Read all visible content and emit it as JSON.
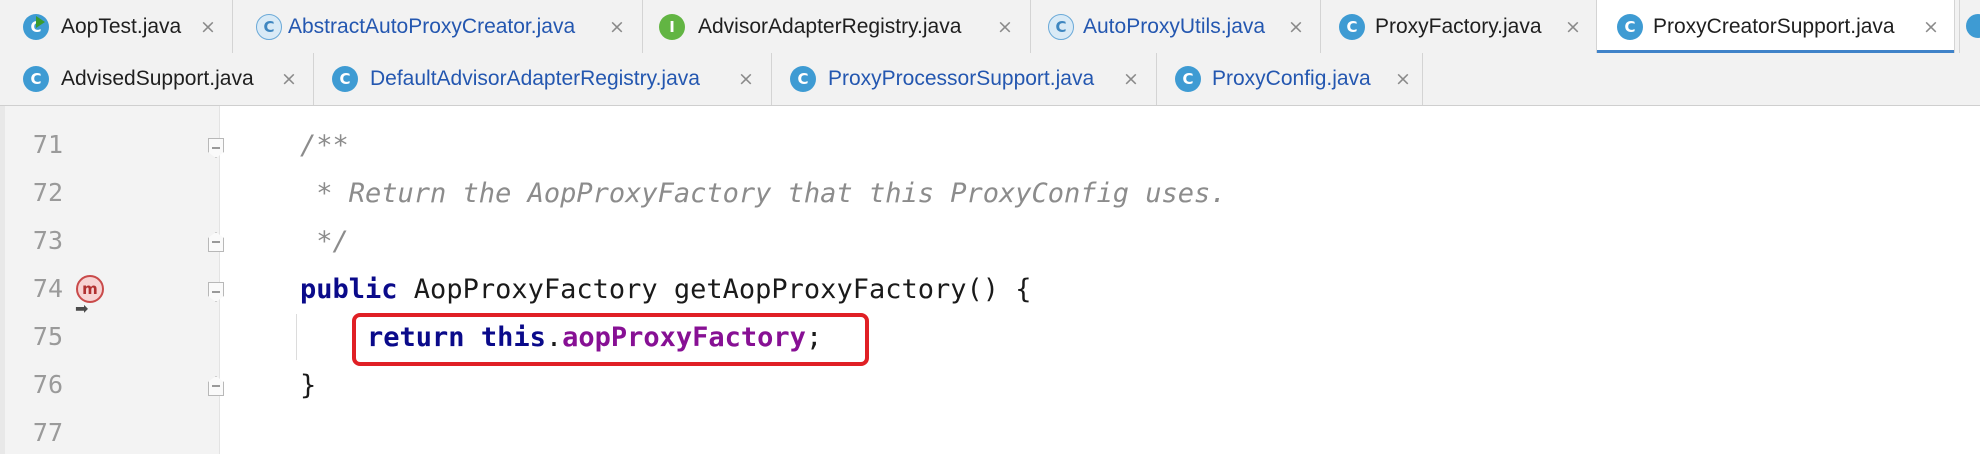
{
  "tabs_row1": [
    {
      "label": "AopTest.java",
      "icon": "c-run-icon",
      "icon_glyph": "C",
      "close": "×",
      "color": "dark"
    },
    {
      "label": "AbstractAutoProxyCreator.java",
      "icon": "class-icon",
      "icon_glyph": "C",
      "close": "×",
      "color": "blue"
    },
    {
      "label": "AdvisorAdapterRegistry.java",
      "icon": "interface-icon",
      "icon_glyph": "I",
      "close": "×",
      "color": "dark"
    },
    {
      "label": "AutoProxyUtils.java",
      "icon": "class-icon",
      "icon_glyph": "C",
      "close": "×",
      "color": "blue"
    },
    {
      "label": "ProxyFactory.java",
      "icon": "class-icon",
      "icon_glyph": "C",
      "close": "×",
      "color": "dark"
    },
    {
      "label": "ProxyCreatorSupport.java",
      "icon": "class-icon",
      "icon_glyph": "C",
      "close": "×",
      "color": "dark",
      "active": true
    }
  ],
  "tabs_row2": [
    {
      "label": "AdvisedSupport.java",
      "icon": "class-icon",
      "icon_glyph": "C",
      "close": "×",
      "color": "dark"
    },
    {
      "label": "DefaultAdvisorAdapterRegistry.java",
      "icon": "class-icon",
      "icon_glyph": "C",
      "close": "×",
      "color": "blue"
    },
    {
      "label": "ProxyProcessorSupport.java",
      "icon": "class-icon",
      "icon_glyph": "C",
      "close": "×",
      "color": "blue"
    },
    {
      "label": "ProxyConfig.java",
      "icon": "class-icon",
      "icon_glyph": "C",
      "close": "×",
      "color": "blue"
    }
  ],
  "line_numbers": [
    "71",
    "72",
    "73",
    "74",
    "75",
    "76",
    "77"
  ],
  "code": {
    "l71": "/**",
    "l72": " * Return the AopProxyFactory that this ProxyConfig uses.",
    "l73": " */",
    "l74_kw": "public",
    "l74_rest": " AopProxyFactory getAopProxyFactory() {",
    "l75_kw1": "return",
    "l75_kw2": "this",
    "l75_dot": ".",
    "l75_field": "aopProxyFactory",
    "l75_end": ";",
    "l76": "}"
  },
  "gutter": {
    "method_badge": "m"
  },
  "colors": {
    "keyword": "#0a0a8a",
    "field": "#871094",
    "comment": "#8c8c8c",
    "highlight_box": "#e02025",
    "active_tab_underline": "#4083c9"
  }
}
